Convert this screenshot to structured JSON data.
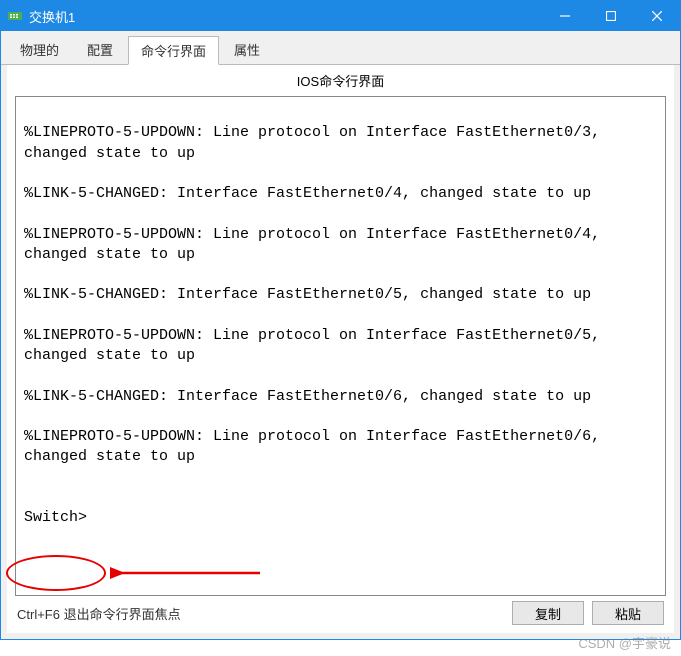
{
  "window": {
    "title": "交换机1"
  },
  "tabs": {
    "items": [
      {
        "label": "物理的",
        "active": false
      },
      {
        "label": "配置",
        "active": false
      },
      {
        "label": "命令行界面",
        "active": true
      },
      {
        "label": "属性",
        "active": false
      }
    ]
  },
  "panel": {
    "title": "IOS命令行界面"
  },
  "terminal": {
    "content": "\n%LINEPROTO-5-UPDOWN: Line protocol on Interface FastEthernet0/3, changed state to up\n\n%LINK-5-CHANGED: Interface FastEthernet0/4, changed state to up\n\n%LINEPROTO-5-UPDOWN: Line protocol on Interface FastEthernet0/4, changed state to up\n\n%LINK-5-CHANGED: Interface FastEthernet0/5, changed state to up\n\n%LINEPROTO-5-UPDOWN: Line protocol on Interface FastEthernet0/5, changed state to up\n\n%LINK-5-CHANGED: Interface FastEthernet0/6, changed state to up\n\n%LINEPROTO-5-UPDOWN: Line protocol on Interface FastEthernet0/6, changed state to up\n\n\nSwitch>"
  },
  "bottom": {
    "hint": "Ctrl+F6 退出命令行界面焦点",
    "copy_label": "复制",
    "paste_label": "粘贴"
  },
  "watermark": "CSDN @宇豪说"
}
